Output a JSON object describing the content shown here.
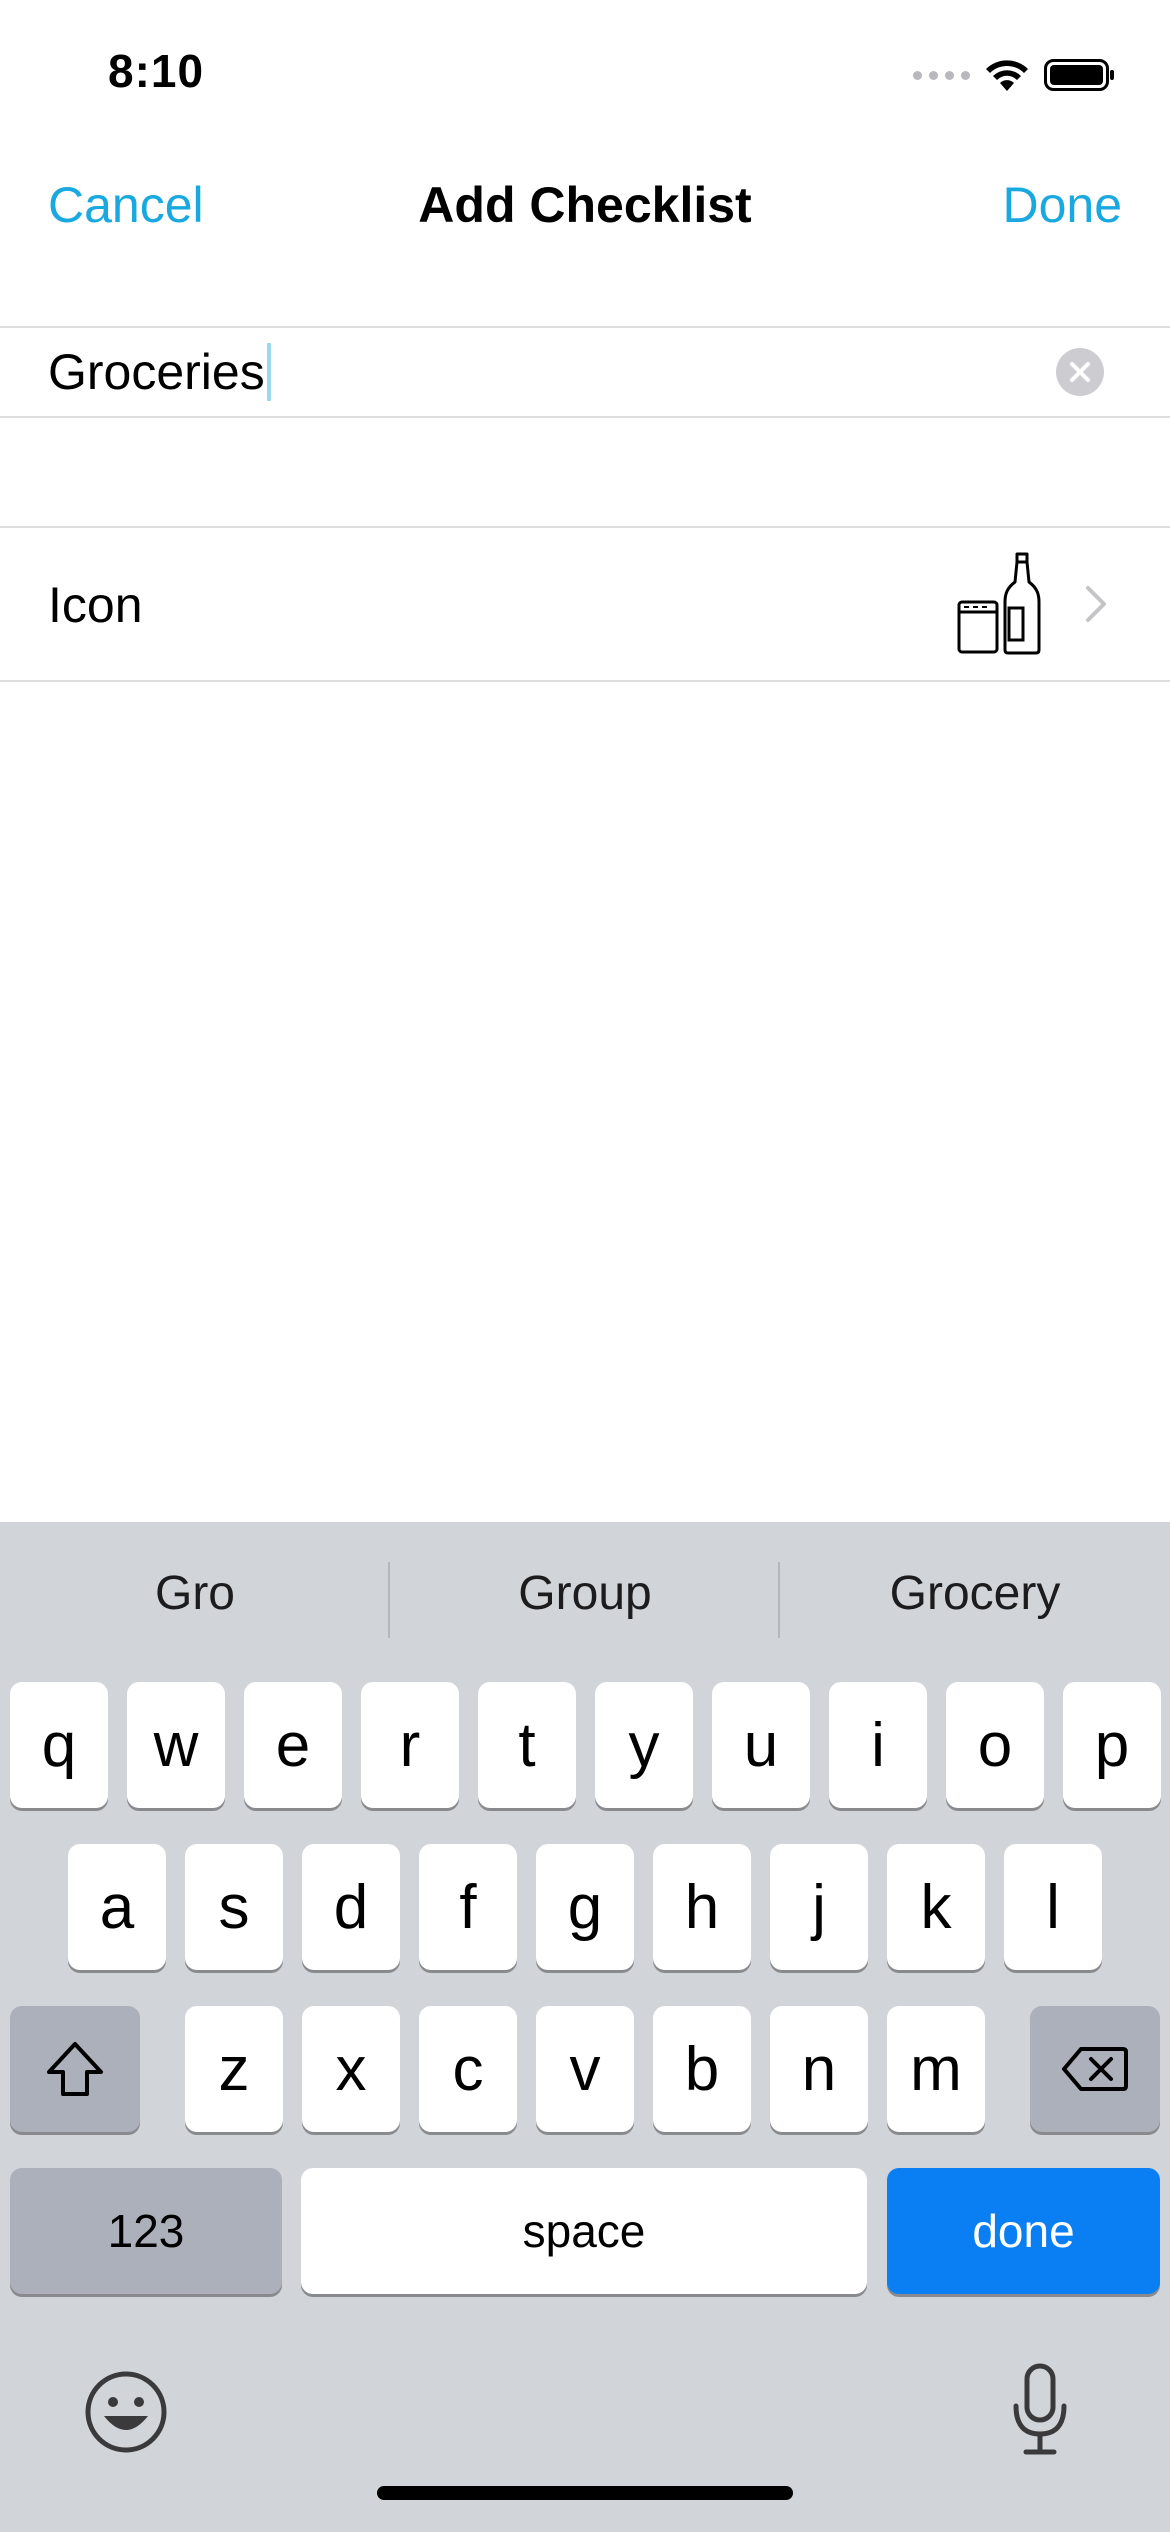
{
  "status_bar": {
    "time": "8:10"
  },
  "nav": {
    "cancel_label": "Cancel",
    "title": "Add Checklist",
    "done_label": "Done"
  },
  "form": {
    "name_value": "Groceries",
    "icon_label": "Icon",
    "icon_name": "groceries-jar-bottle-icon"
  },
  "keyboard": {
    "suggestions": [
      "Gro",
      "Group",
      "Grocery"
    ],
    "row1": [
      "q",
      "w",
      "e",
      "r",
      "t",
      "y",
      "u",
      "i",
      "o",
      "p"
    ],
    "row2": [
      "a",
      "s",
      "d",
      "f",
      "g",
      "h",
      "j",
      "k",
      "l"
    ],
    "row3": [
      "z",
      "x",
      "c",
      "v",
      "b",
      "n",
      "m"
    ],
    "numbers_label": "123",
    "space_label": "space",
    "done_label": "done"
  },
  "colors": {
    "accent": "#19a8df",
    "keyboard_bg": "#d1d4d9",
    "done_key": "#0a7ff4"
  }
}
